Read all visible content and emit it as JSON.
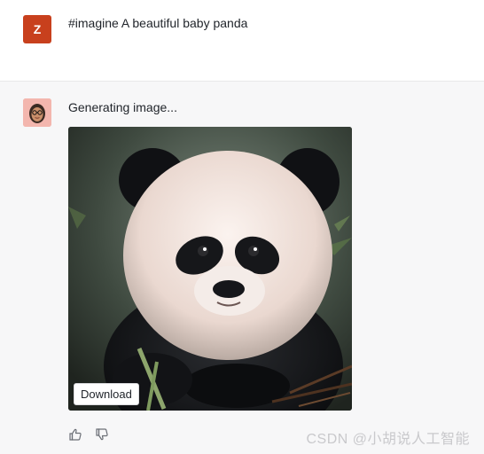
{
  "conversation": {
    "user_message": {
      "avatar_letter": "Z",
      "avatar_color": "#c8401d",
      "text": "#imagine A beautiful baby panda"
    },
    "bot_message": {
      "status_text": "Generating image...",
      "image": {
        "subject": "baby-panda-image",
        "download_label": "Download"
      },
      "actions": {
        "like_icon": "thumbs-up-icon",
        "dislike_icon": "thumbs-down-icon"
      }
    }
  },
  "watermark": "CSDN @小胡说人工智能",
  "colors": {
    "user_bg": "#ffffff",
    "bot_bg": "#f7f7f8",
    "divider": "#e8e8ea"
  }
}
